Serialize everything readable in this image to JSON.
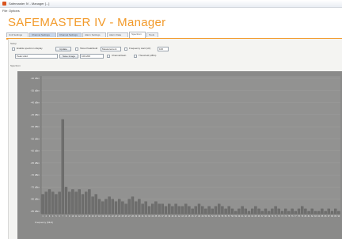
{
  "window": {
    "title": "Safemaster IV - Manager [...]"
  },
  "menu": [
    "File",
    "Options"
  ],
  "app_heading": "SAFEMASTER IV - Manager",
  "tabs": [
    {
      "label": "Unit Settings",
      "active": false
    },
    {
      "label": "Channel Settings",
      "active": false
    },
    {
      "label": "Channel Settings",
      "active": false
    },
    {
      "label": "Alarm Settings",
      "active": false
    },
    {
      "label": "Alarm Data",
      "active": false
    },
    {
      "label": "Spectrum",
      "active": true
    },
    {
      "label": "Tools",
      "active": false
    }
  ],
  "controls": {
    "section_label": "Setup",
    "enable_checkbox_label": "Enable spectrum display",
    "update_button": "Update",
    "peak_checkbox_label": "Show Peak/Hold",
    "peak_value": "Measurement",
    "frequency_label": "Frequency start (Hz)",
    "frequency_value": "100",
    "mode_select": "Peak Hold",
    "save_button": "Save Image",
    "range_value": "100-200",
    "checkbox2_label": "Channel/Gain",
    "threshold_label": "Threshold (dBm)"
  },
  "chart_label": "Spectrum",
  "chart_data": {
    "type": "bar",
    "categories": [
      "1",
      "2",
      "3",
      "4",
      "5",
      "6",
      "7",
      "8",
      "9",
      "10",
      "11",
      "12",
      "13",
      "14",
      "15",
      "16",
      "17",
      "18",
      "19",
      "20",
      "21",
      "22",
      "23",
      "24",
      "25",
      "26",
      "27",
      "28",
      "29",
      "30",
      "31",
      "32",
      "33",
      "34",
      "35",
      "36",
      "37",
      "38",
      "39",
      "40",
      "41",
      "42",
      "43",
      "44",
      "45",
      "46",
      "47",
      "48",
      "49",
      "50",
      "51",
      "52",
      "53",
      "54",
      "55",
      "56",
      "57",
      "58",
      "59",
      "60",
      "61",
      "62",
      "63",
      "64",
      "65",
      "66",
      "67",
      "68",
      "69",
      "70",
      "71",
      "72",
      "73",
      "74",
      "75",
      "76",
      "77",
      "78",
      "79",
      "80",
      "81",
      "82",
      "83",
      "84",
      "85",
      "86",
      "87",
      "88",
      "89",
      "90"
    ],
    "values": [
      -78,
      -77,
      -76,
      -77,
      -78,
      -77,
      -47,
      -75,
      -77,
      -76,
      -77,
      -76,
      -78,
      -77,
      -76,
      -79,
      -78,
      -80,
      -81,
      -80,
      -79,
      -80,
      -81,
      -80,
      -81,
      -82,
      -80,
      -79,
      -81,
      -80,
      -82,
      -81,
      -83,
      -82,
      -81,
      -82,
      -82,
      -83,
      -82,
      -83,
      -82,
      -83,
      -83,
      -82,
      -83,
      -84,
      -83,
      -82,
      -83,
      -84,
      -83,
      -84,
      -83,
      -82,
      -83,
      -84,
      -83,
      -84,
      -85,
      -84,
      -83,
      -84,
      -85,
      -84,
      -83,
      -84,
      -85,
      -84,
      -85,
      -84,
      -83,
      -84,
      -85,
      -84,
      -85,
      -84,
      -85,
      -84,
      -83,
      -84,
      -85,
      -84,
      -85,
      -85,
      -84,
      -85,
      -84,
      -85,
      -84,
      -85
    ],
    "yticks": [
      "-30 dBm",
      "-35 dBm",
      "-40 dBm",
      "-45 dBm",
      "-50 dBm",
      "-55 dBm",
      "-60 dBm",
      "-65 dBm",
      "-70 dBm",
      "-75 dBm",
      "-80 dBm",
      "-85 dBm"
    ],
    "ylim": [
      -86,
      -29
    ],
    "xlabel": "Frequency (MHz)",
    "grid": true,
    "colors": {
      "background": "#8a8a89",
      "grid": "#9d9d9c",
      "bar": "#6e6e6d",
      "bar_edge": "#5b5b5a"
    }
  }
}
